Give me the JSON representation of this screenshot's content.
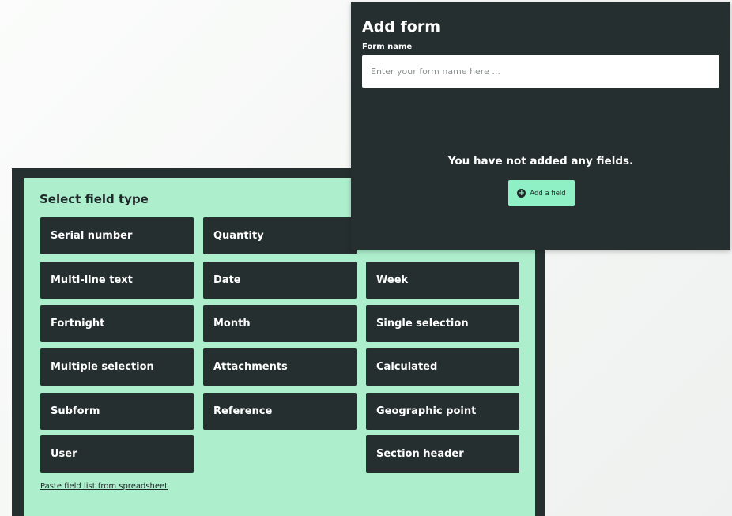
{
  "field_selector": {
    "title": "Select field type",
    "buttons": [
      "Serial number",
      "Quantity",
      "Multi-line text",
      "Date",
      "Week",
      "Fortnight",
      "Month",
      "Single selection",
      "Multiple selection",
      "Attachments",
      "Calculated",
      "Subform",
      "Reference",
      "Geographic point",
      "User",
      "Section header"
    ],
    "paste_link": "Paste field list from spreadsheet"
  },
  "add_form": {
    "title": "Add form",
    "form_name_label": "Form name",
    "form_name_placeholder": "Enter your form name here ...",
    "form_name_value": "",
    "empty_message": "You have not added any fields.",
    "add_field_label": "Add a field",
    "add_field_icon": "plus-circle-icon"
  },
  "colors": {
    "dark": "#262f2f",
    "mint_panel": "#adeecd",
    "accent_button": "#8ef0c4"
  }
}
